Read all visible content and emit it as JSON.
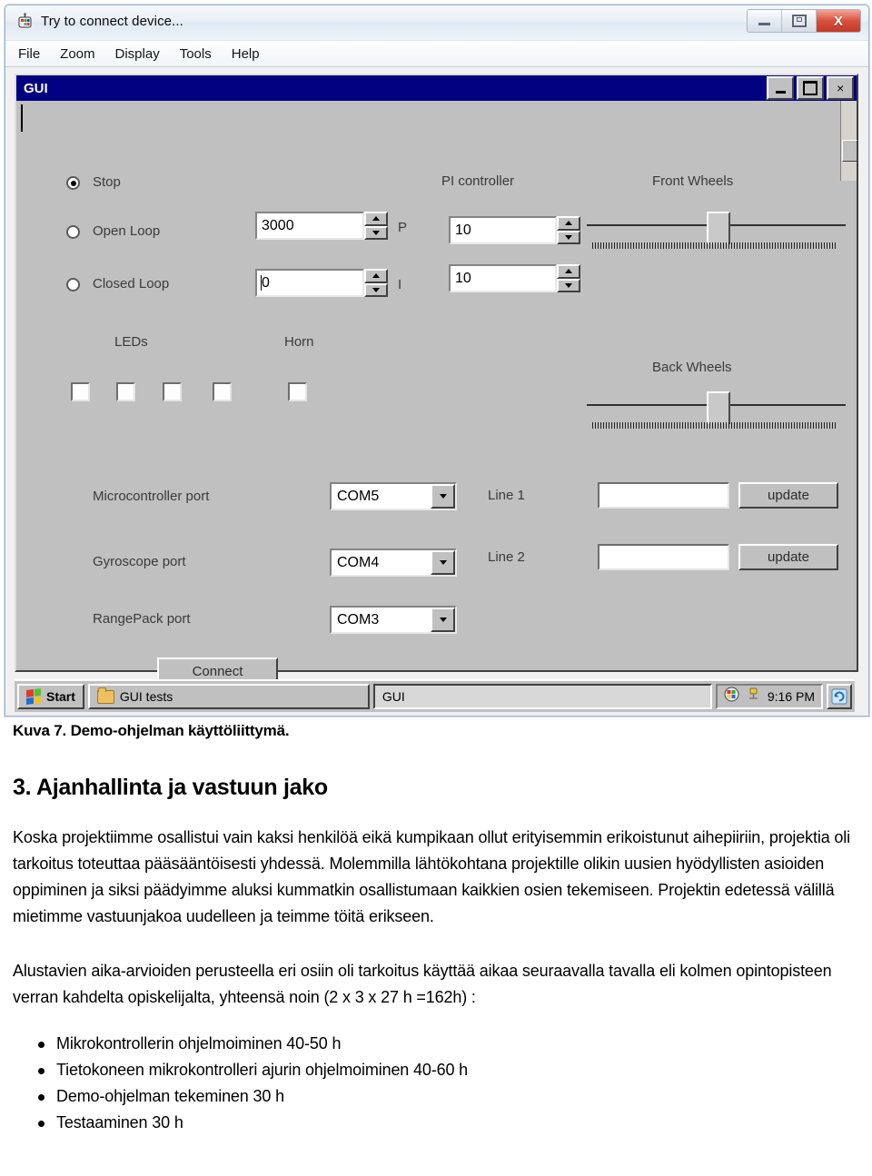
{
  "window": {
    "title": "Try to connect device...",
    "icon": "robot-icon",
    "controls": {
      "minimize": "minimize-icon",
      "maximize": "maximize-icon",
      "close": "X"
    },
    "menu": [
      "File",
      "Zoom",
      "Display",
      "Tools",
      "Help"
    ]
  },
  "mdi": {
    "title": "GUI",
    "controls": {
      "minimize": "minimize-icon",
      "maximize": "maximize-icon",
      "close": "×"
    }
  },
  "controls": {
    "mode_radios": [
      {
        "label": "Stop",
        "selected": true
      },
      {
        "label": "Open Loop",
        "selected": false
      },
      {
        "label": "Closed Loop",
        "selected": false
      }
    ],
    "motor_spinners": [
      {
        "value": "3000",
        "suffix": "P"
      },
      {
        "value": "0",
        "suffix": "I"
      }
    ],
    "pi_controller": {
      "label": "PI controller",
      "spinners": [
        {
          "value": "10"
        },
        {
          "value": "10"
        }
      ]
    },
    "front_wheels": {
      "label": "Front Wheels",
      "position_percent": 50
    },
    "back_wheels": {
      "label": "Back Wheels",
      "position_percent": 50
    },
    "leds": {
      "label": "LEDs",
      "count": 4,
      "checked": [
        false,
        false,
        false,
        false
      ]
    },
    "horn": {
      "label": "Horn",
      "checked": false
    },
    "ports": [
      {
        "label": "Microcontroller port",
        "value": "COM5"
      },
      {
        "label": "Gyroscope port",
        "value": "COM4"
      },
      {
        "label": "RangePack port",
        "value": "COM3"
      }
    ],
    "lines": [
      {
        "label": "Line 1",
        "value": "",
        "button": "update"
      },
      {
        "label": "Line 2",
        "value": "",
        "button": "update"
      }
    ],
    "connect_button": "Connect"
  },
  "taskbar": {
    "start": "Start",
    "tasks": [
      {
        "label": "GUI tests",
        "icon": "folder-icon",
        "active": false
      },
      {
        "label": "GUI",
        "icon": "",
        "active": true
      }
    ],
    "tray": {
      "time": "9:16 PM",
      "icons": [
        "app-tray-icon",
        "plug-icon",
        "refresh-icon"
      ]
    }
  },
  "document": {
    "caption": "Kuva 7. Demo-ohjelman käyttöliittymä.",
    "heading": "3. Ajanhallinta ja vastuun jako",
    "paragraph1": "Koska projektiimme osallistui vain kaksi henkilöä eikä kumpikaan ollut erityisemmin erikoistunut aihepiiriin, projektia oli tarkoitus toteuttaa pääsääntöisesti yhdessä. Molemmilla lähtökohtana projektille olikin uusien hyödyllisten asioiden oppiminen ja siksi päädyimme aluksi kummatkin osallistumaan kaikkien osien tekemiseen. Projektin edetessä välillä mietimme vastuunjakoa uudelleen ja teimme töitä erikseen.",
    "paragraph2": "Alustavien aika-arvioiden perusteella eri osiin oli tarkoitus käyttää aikaa seuraavalla tavalla eli kolmen opintopisteen verran kahdelta opiskelijalta, yhteensä noin  (2 x 3 x 27 h =162h) :",
    "bullets": [
      "Mikrokontrollerin ohjelmoiminen 40-50 h",
      "Tietokoneen mikrokontrolleri ajurin ohjelmoiminen 40-60 h",
      "Demo-ohjelman tekeminen 30 h",
      "Testaaminen 30 h"
    ]
  }
}
